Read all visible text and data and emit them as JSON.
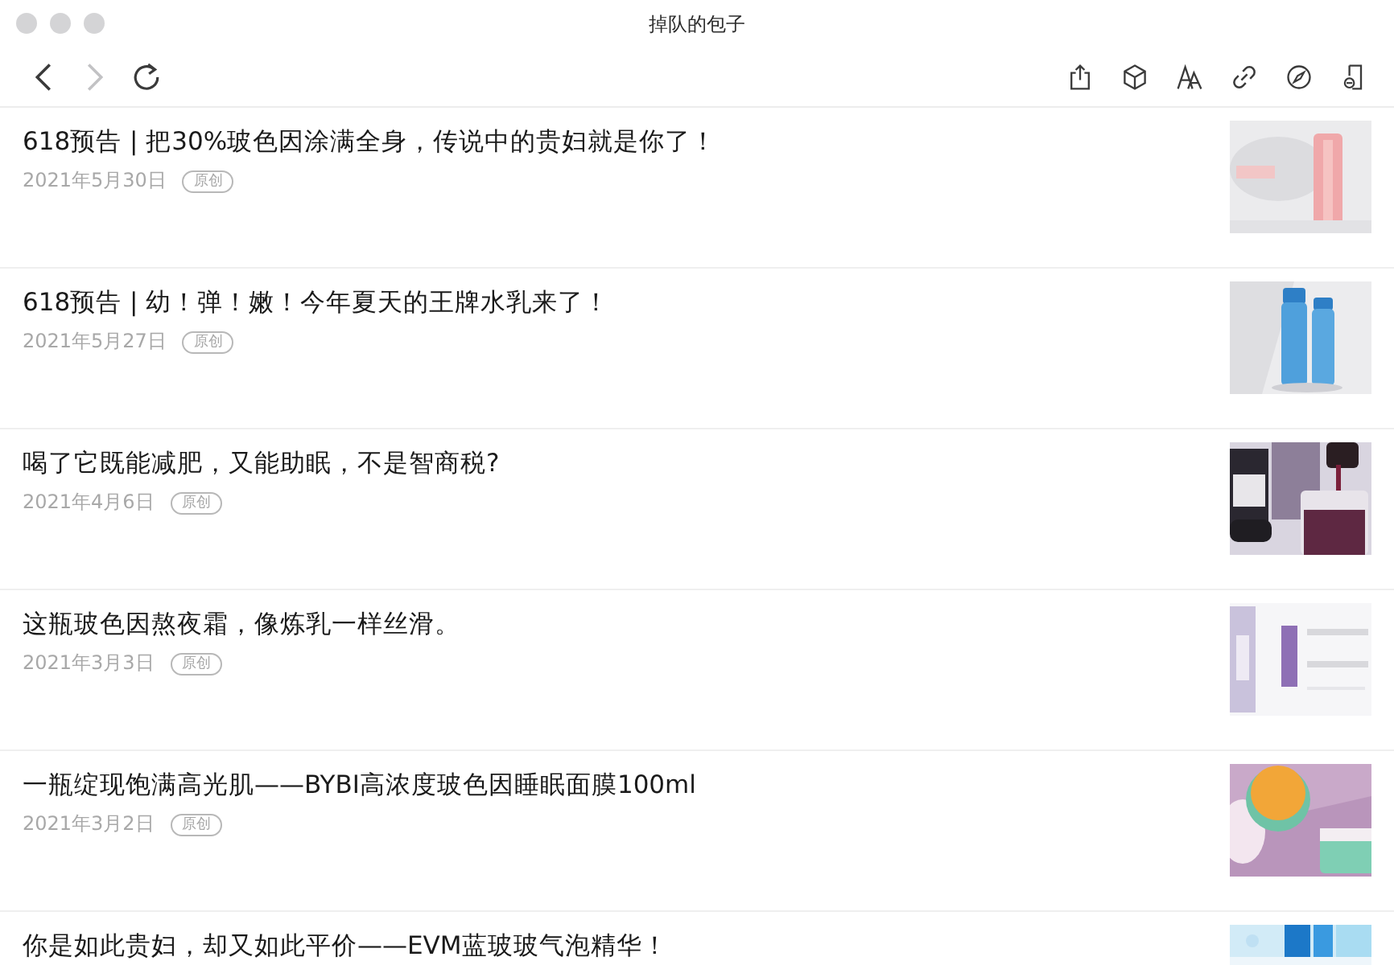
{
  "window": {
    "title": "掉队的包子"
  },
  "toolbar": {
    "nav_buttons": [
      {
        "kind": "back",
        "disabled": false
      },
      {
        "kind": "forward",
        "disabled": true
      },
      {
        "kind": "reload",
        "disabled": false
      }
    ],
    "actions": [
      {
        "kind": "share"
      },
      {
        "kind": "cube"
      },
      {
        "kind": "font"
      },
      {
        "kind": "link"
      },
      {
        "kind": "compass"
      },
      {
        "kind": "reader"
      }
    ]
  },
  "articles": [
    {
      "title": "618预告 | 把30%玻色因涂满全身，传说中的贵妇就是你了！",
      "date": "2021年5月30日",
      "badge": "原创"
    },
    {
      "title": "618预告 | 幼！弹！嫩！今年夏天的王牌水乳来了！",
      "date": "2021年5月27日",
      "badge": "原创"
    },
    {
      "title": "喝了它既能减肥，又能助眠，不是智商税?",
      "date": "2021年4月6日",
      "badge": "原创"
    },
    {
      "title": "这瓶玻色因熬夜霜，像炼乳一样丝滑。",
      "date": "2021年3月3日",
      "badge": "原创"
    },
    {
      "title": "一瓶绽现饱满高光肌——BYBI高浓度玻色因睡眠面膜100ml",
      "date": "2021年3月2日",
      "badge": "原创"
    },
    {
      "title": "你是如此贵妇，却又如此平价——EVM蓝玻玻气泡精华！"
    }
  ]
}
